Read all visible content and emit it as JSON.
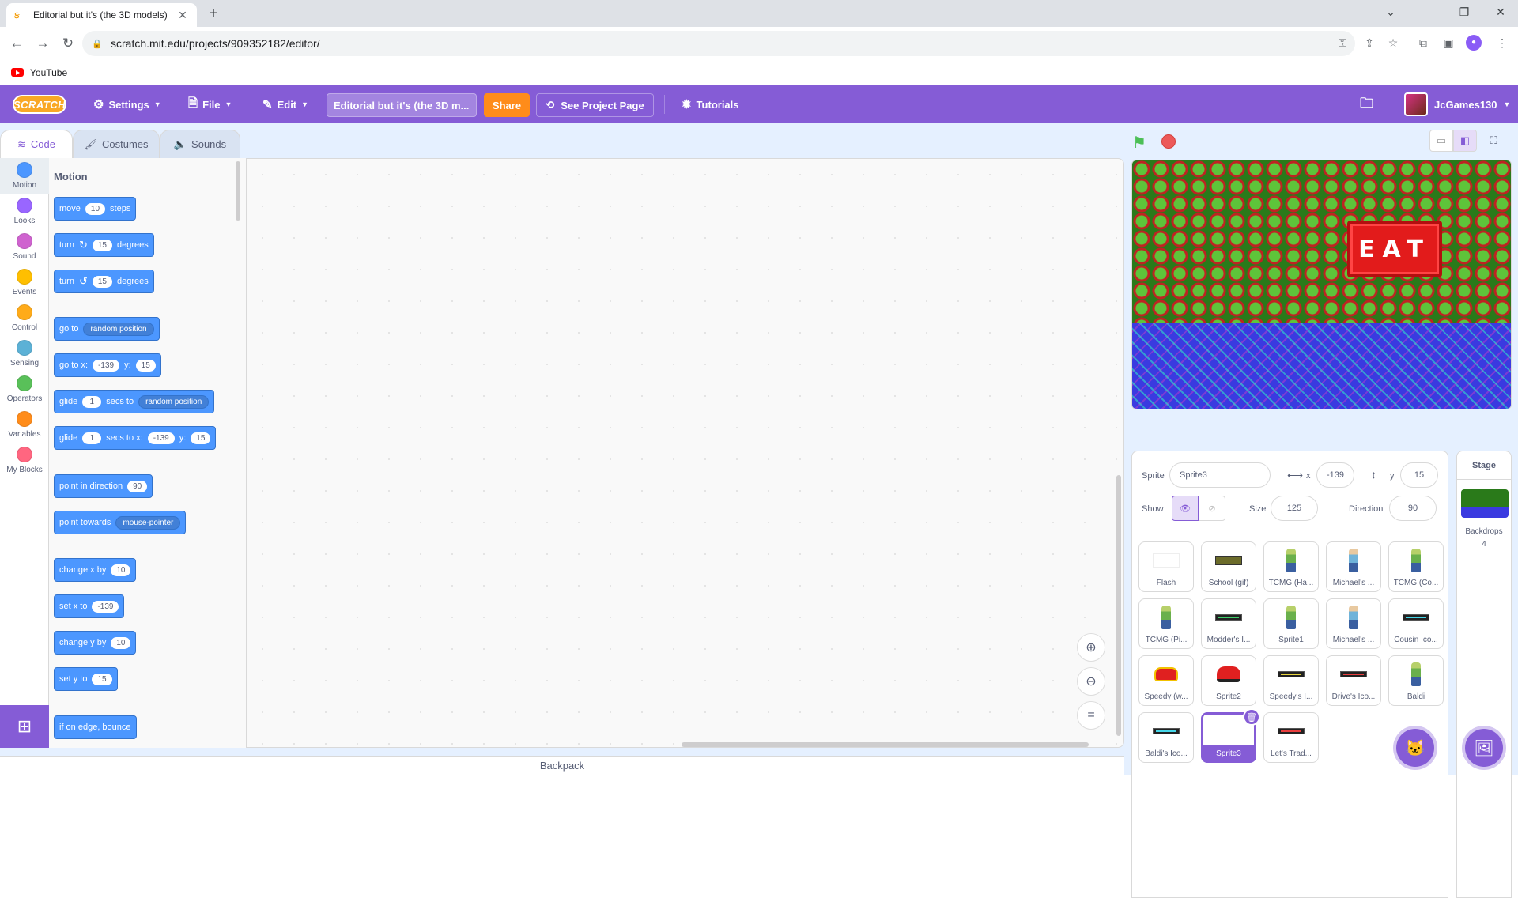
{
  "browser": {
    "tab_title": "Editorial but it's (the 3D models)",
    "url": "scratch.mit.edu/projects/909352182/editor/",
    "bookmark": "YouTube"
  },
  "menubar": {
    "logo": "SCRATCH",
    "settings": "Settings",
    "file": "File",
    "edit": "Edit",
    "project_title": "Editorial but it's (the 3D m...",
    "share": "Share",
    "see_project_page": "See Project Page",
    "tutorials": "Tutorials",
    "username": "JcGames130"
  },
  "editor_tabs": [
    "Code",
    "Costumes",
    "Sounds"
  ],
  "categories": [
    {
      "label": "Motion",
      "color": "#4c97ff"
    },
    {
      "label": "Looks",
      "color": "#9966ff"
    },
    {
      "label": "Sound",
      "color": "#cf63cf"
    },
    {
      "label": "Events",
      "color": "#ffbf00"
    },
    {
      "label": "Control",
      "color": "#ffab19"
    },
    {
      "label": "Sensing",
      "color": "#5cb1d6"
    },
    {
      "label": "Operators",
      "color": "#59c059"
    },
    {
      "label": "Variables",
      "color": "#ff8c1a"
    },
    {
      "label": "My Blocks",
      "color": "#ff6680"
    }
  ],
  "palette": {
    "heading": "Motion",
    "move": {
      "a": "move",
      "n": "10",
      "b": "steps"
    },
    "turn_right": {
      "a": "turn",
      "n": "15",
      "b": "degrees"
    },
    "turn_left": {
      "a": "turn",
      "n": "15",
      "b": "degrees"
    },
    "goto": {
      "a": "go to",
      "dd": "random position"
    },
    "goto_xy": {
      "a": "go to x:",
      "x": "-139",
      "b": "y:",
      "y": "15"
    },
    "glide": {
      "a": "glide",
      "n": "1",
      "b": "secs to",
      "dd": "random position"
    },
    "glide_xy": {
      "a": "glide",
      "n": "1",
      "b": "secs to x:",
      "x": "-139",
      "c": "y:",
      "y": "15"
    },
    "point_dir": {
      "a": "point in direction",
      "n": "90"
    },
    "point_towards": {
      "a": "point towards",
      "dd": "mouse-pointer"
    },
    "change_x": {
      "a": "change x by",
      "n": "10"
    },
    "set_x": {
      "a": "set x to",
      "n": "-139"
    },
    "change_y": {
      "a": "change y by",
      "n": "10"
    },
    "set_y": {
      "a": "set y to",
      "n": "15"
    },
    "bounce": {
      "a": "if on edge, bounce"
    }
  },
  "backpack": "Backpack",
  "stage": {
    "sign_text": "EAT"
  },
  "sprite_info": {
    "sprite_label": "Sprite",
    "sprite_name": "Sprite3",
    "x_label": "x",
    "x": "-139",
    "y_label": "y",
    "y": "15",
    "show_label": "Show",
    "size_label": "Size",
    "size": "125",
    "direction_label": "Direction",
    "direction": "90"
  },
  "sprites": [
    {
      "name": "Flash",
      "thumb": "white"
    },
    {
      "name": "School (gif)",
      "thumb": "school"
    },
    {
      "name": "TCMG (Ha...",
      "thumb": "person"
    },
    {
      "name": "Michael's ...",
      "thumb": "person2"
    },
    {
      "name": "TCMG (Co...",
      "thumb": "person"
    },
    {
      "name": "TCMG (Pi...",
      "thumb": "person"
    },
    {
      "name": "Modder's I...",
      "thumb": "bar-green"
    },
    {
      "name": "Sprite1",
      "thumb": "person"
    },
    {
      "name": "Michael's ...",
      "thumb": "person2"
    },
    {
      "name": "Cousin Ico...",
      "thumb": "bar-cyan"
    },
    {
      "name": "Speedy (w...",
      "thumb": "car"
    },
    {
      "name": "Sprite2",
      "thumb": "car"
    },
    {
      "name": "Speedy's I...",
      "thumb": "bar-yellow"
    },
    {
      "name": "Drive's Ico...",
      "thumb": "bar-red"
    },
    {
      "name": "Baldi",
      "thumb": "person"
    },
    {
      "name": "Baldi's Ico...",
      "thumb": "bar-cyan"
    },
    {
      "name": "Sprite3",
      "thumb": "selected"
    },
    {
      "name": "Let's Trad...",
      "thumb": "bar-red"
    }
  ],
  "stage_panel": {
    "label": "Stage",
    "backdrops_label": "Backdrops",
    "backdrops_count": "4"
  }
}
